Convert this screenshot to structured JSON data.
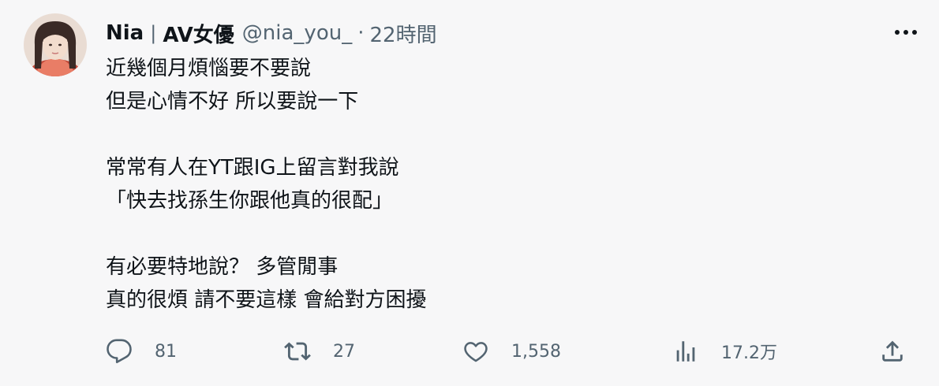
{
  "author": {
    "display_name": "Nia",
    "separator": "|",
    "tag": "AV女優",
    "handle": "@nia_you_",
    "dot": "·",
    "time": "22時間"
  },
  "body_lines": [
    "近幾個月煩惱要不要說",
    "但是心情不好 所以要說一下",
    "",
    "常常有人在YT跟IG上留言對我說",
    "「快去找孫生你跟他真的很配」",
    "",
    "有必要特地說？ 多管閒事",
    "真的很煩 請不要這樣 會給對方困擾"
  ],
  "actions": {
    "reply_count": "81",
    "retweet_count": "27",
    "like_count": "1,558",
    "views_count": "17.2万"
  },
  "icons": {
    "more": "more-horizontal-icon",
    "reply": "reply-bubble-icon",
    "retweet": "retweet-icon",
    "like": "heart-icon",
    "views": "bar-chart-icon",
    "share": "share-upload-icon"
  },
  "colors": {
    "background": "#f7f7f8",
    "text": "#0f1419",
    "secondary": "#536471"
  }
}
